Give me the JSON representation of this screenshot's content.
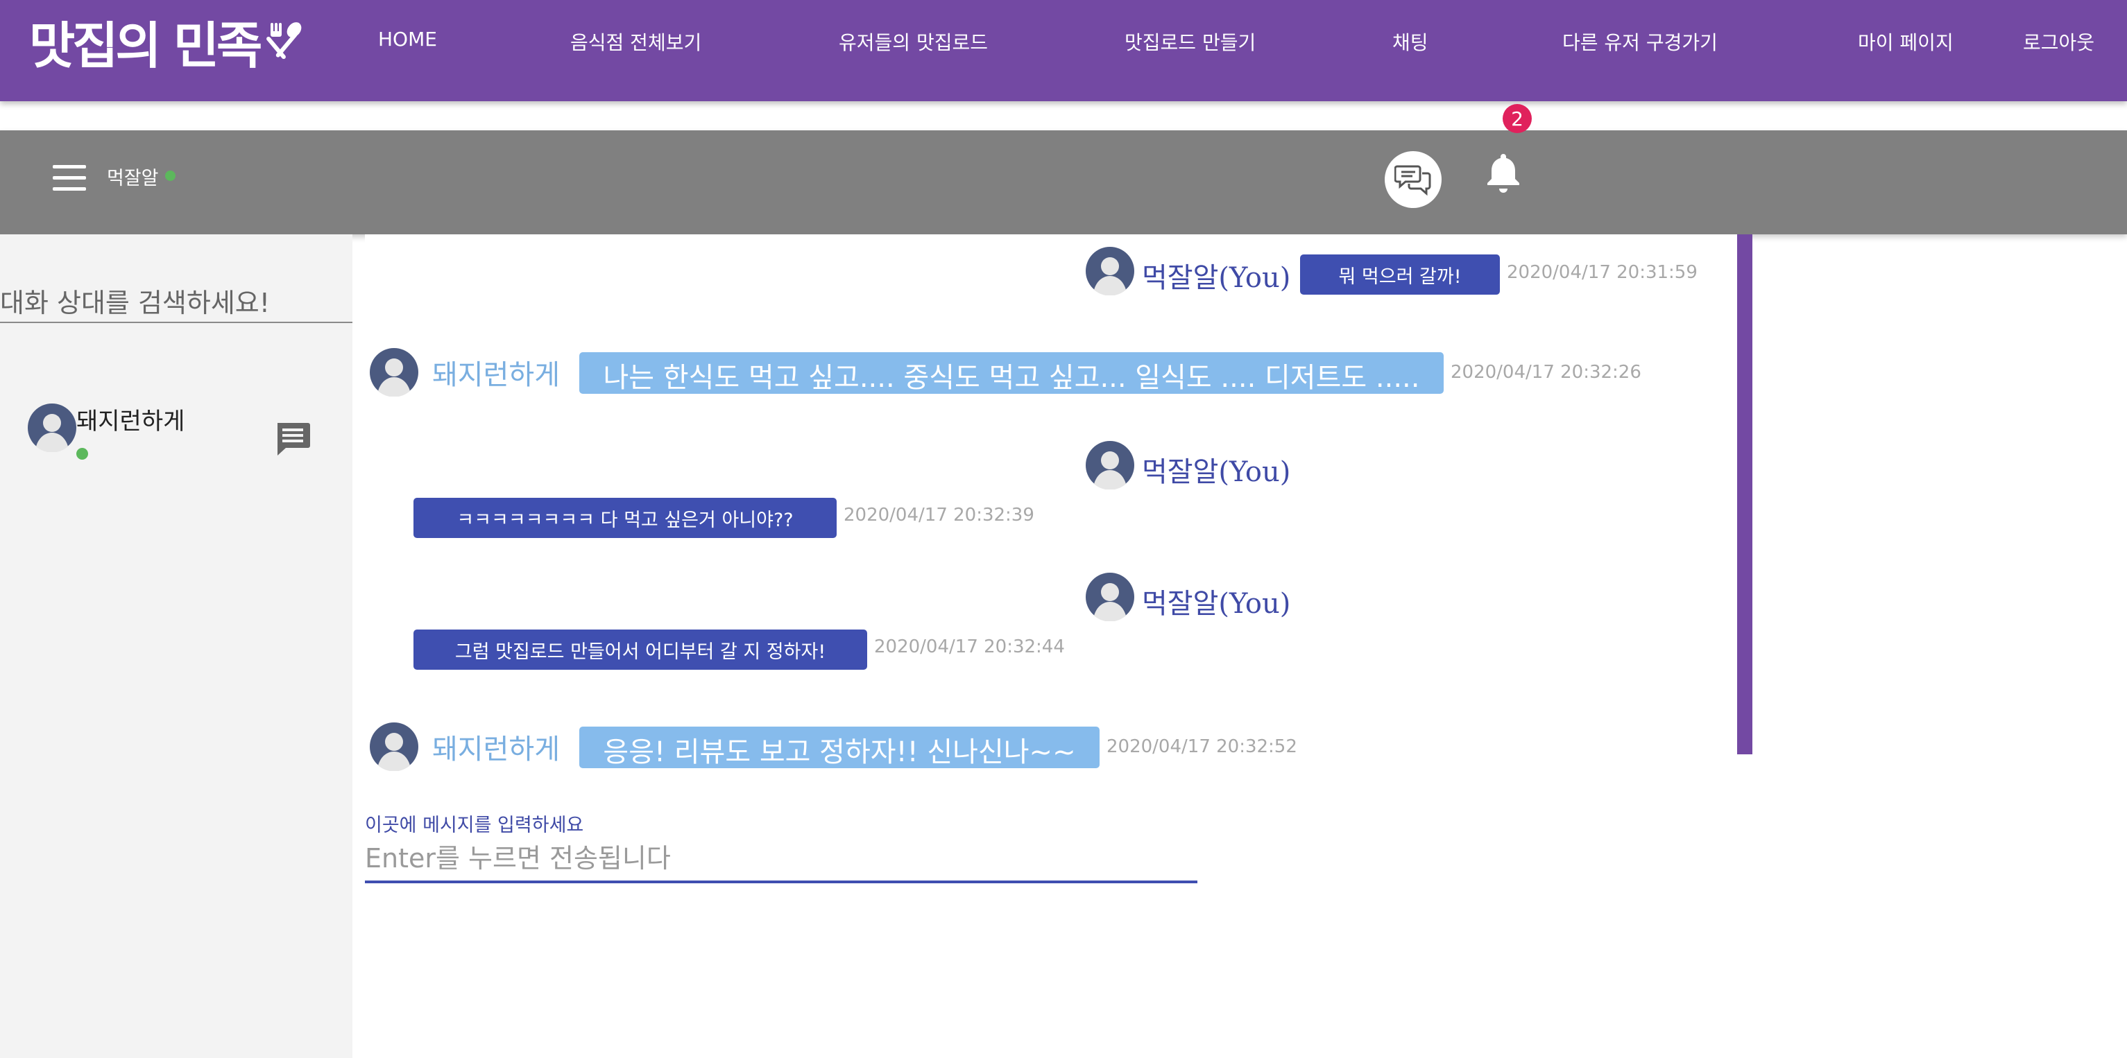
{
  "brand": {
    "logo_text": "맛집의 민족",
    "logo_icon": "fork-spoon-icon"
  },
  "nav": {
    "items": [
      {
        "label": "HOME"
      },
      {
        "label": "음식점 전체보기"
      },
      {
        "label": "유저들의 맛집로드"
      },
      {
        "label": "맛집로드 만들기"
      },
      {
        "label": "채팅"
      },
      {
        "label": "다른 유저 구경가기"
      },
      {
        "label": "마이 페이지"
      },
      {
        "label": "로그아웃"
      }
    ]
  },
  "subbar": {
    "menu_icon": "hamburger-menu-icon",
    "current_user": "먹잘알",
    "chat_icon": "chat-bubbles-icon",
    "bell_icon": "bell-icon",
    "notification_count": "2"
  },
  "sidebar": {
    "search_placeholder": "대화 상대를 검색하세요!",
    "contacts": [
      {
        "name": "돼지런하게",
        "online": true,
        "icon": "message-icon"
      }
    ]
  },
  "chat": {
    "messages": [
      {
        "sender": "먹잘알(You)",
        "mine": true,
        "text": "뭐 먹으러 갈까!",
        "time": "2020/04/17 20:31:59"
      },
      {
        "sender": "돼지런하게",
        "mine": false,
        "text": "나는 한식도 먹고 싶고.... 중식도 먹고 싶고... 일식도 .... 디저트도 .....",
        "time": "2020/04/17 20:32:26"
      },
      {
        "sender": "먹잘알(You)",
        "mine": true,
        "text": "ㅋㅋㅋㅋㅋㅋㅋㅋ 다 먹고 싶은거 아니야??",
        "time": "2020/04/17 20:32:39"
      },
      {
        "sender": "먹잘알(You)",
        "mine": true,
        "text": "그럼 맛집로드 만들어서 어디부터 갈 지 정하자!",
        "time": "2020/04/17 20:32:44"
      },
      {
        "sender": "돼지런하게",
        "mine": false,
        "text": "응응! 리뷰도 보고 정하자!! 신나신나~~",
        "time": "2020/04/17 20:32:52"
      }
    ]
  },
  "composer": {
    "label": "이곳에 메시지를 입력하세요",
    "placeholder": "Enter를 누르면 전송됩니다"
  },
  "colors": {
    "brand_purple": "#7349a3",
    "bubble_mine": "#3f4fb0",
    "bubble_other": "#86bbec",
    "online": "#5cb85c",
    "badge": "#e0215c"
  }
}
